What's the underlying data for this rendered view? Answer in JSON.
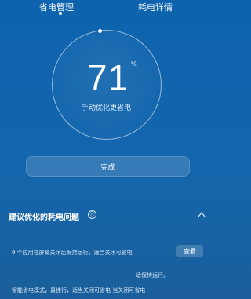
{
  "tabs": [
    "省电管理",
    "耗电详情"
  ],
  "gauge": {
    "score": "71",
    "unit": "%",
    "subtitle": "手动优化更省电"
  },
  "actions": {
    "done": "完成",
    "view": "查看"
  },
  "section": {
    "title": "建议优化的耗电问题",
    "badge": "⑪"
  },
  "issues": {
    "line1": "9 个应用在屏幕关闭后保持运行，适当关闭可省电",
    "line2": "适保持运行。",
    "line3": "智能省电模式，最佳行，适当关闭可省电  当关闭可省电"
  },
  "icons": {
    "chevron_up": "chevron-up-icon",
    "info": "info-icon"
  }
}
